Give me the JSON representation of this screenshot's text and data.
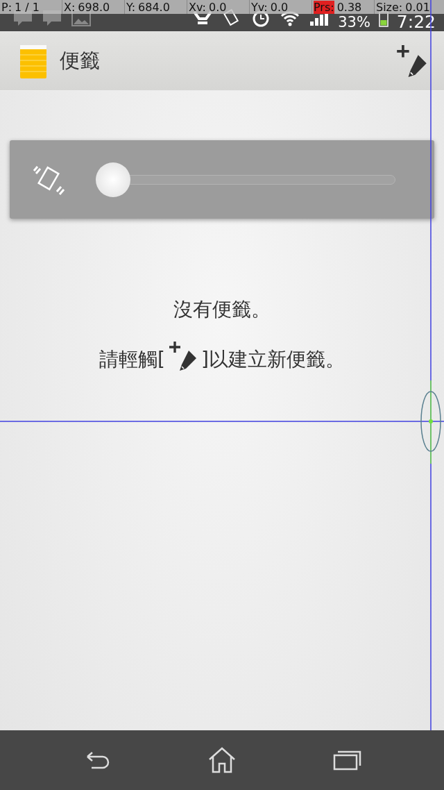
{
  "pointer_overlay": [
    {
      "label": "P:",
      "value": "1 / 1",
      "alert": false
    },
    {
      "label": "X:",
      "value": "698.0",
      "alert": false
    },
    {
      "label": "Y:",
      "value": "684.0",
      "alert": false
    },
    {
      "label": "Xv:",
      "value": "0.0",
      "alert": false
    },
    {
      "label": "Yv:",
      "value": "0.0",
      "alert": false
    },
    {
      "label": "Prs:",
      "value": "0.38",
      "alert": true
    },
    {
      "label": "Size:",
      "value": "0.01",
      "alert": false
    }
  ],
  "status_bar": {
    "battery": "33%",
    "time": "7:22"
  },
  "action_bar": {
    "title": "便籤"
  },
  "vibration_slider": {
    "level": 0
  },
  "empty_state": {
    "message": "沒有便籤。",
    "hint_before": "請輕觸[",
    "hint_after": "]以建立新便籤。"
  }
}
